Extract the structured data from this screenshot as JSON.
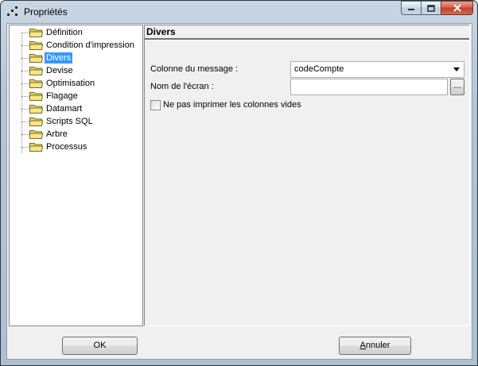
{
  "window": {
    "title": "Propriétés"
  },
  "tree": {
    "items": [
      {
        "label": "Définition",
        "selected": false
      },
      {
        "label": "Condition d'impression",
        "selected": false
      },
      {
        "label": "Divers",
        "selected": true
      },
      {
        "label": "Devise",
        "selected": false
      },
      {
        "label": "Optimisation",
        "selected": false
      },
      {
        "label": "Flagage",
        "selected": false
      },
      {
        "label": "Datamart",
        "selected": false
      },
      {
        "label": "Scripts SQL",
        "selected": false
      },
      {
        "label": "Arbre",
        "selected": false
      },
      {
        "label": "Processus",
        "selected": false
      }
    ]
  },
  "panel": {
    "title": "Divers",
    "message_column_label": "Colonne du message :",
    "message_column_value": "codeCompte",
    "screen_name_label": "Nom de l'écran :",
    "screen_name_value": "",
    "browse_label": "...",
    "hide_empty_label": "Ne pas imprimer les colonnes vides",
    "hide_empty_checked": false
  },
  "buttons": {
    "ok_label": "OK",
    "cancel_first": "A",
    "cancel_rest": "nnuler"
  },
  "colors": {
    "selection": "#3399ff",
    "close_button": "#c0402b"
  },
  "icons": [
    "app-icon",
    "minimize-icon",
    "maximize-icon",
    "close-icon",
    "folder-icon",
    "dropdown-arrow-icon"
  ]
}
